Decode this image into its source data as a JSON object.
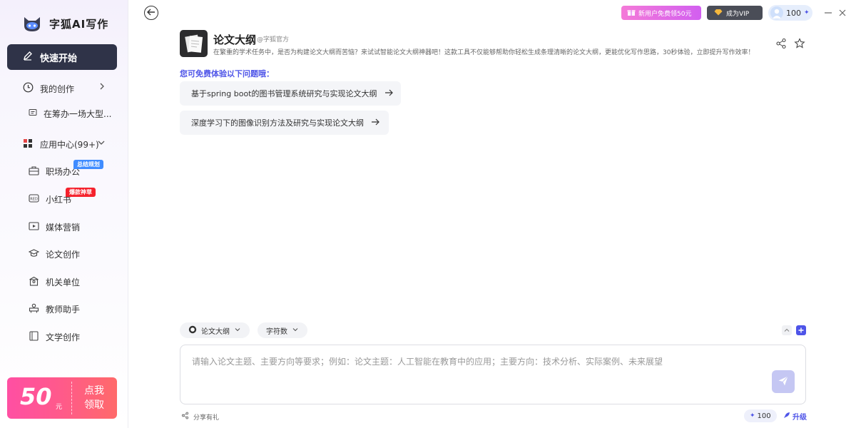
{
  "brand": {
    "name": "字狐AI写作"
  },
  "sidebar": {
    "quick_start": "快速开始",
    "my_creations": "我的创作",
    "recent_item": "在筹办一场大型...",
    "app_center": "应用中心(99+)",
    "apps": [
      {
        "label": "职场办公",
        "badge": "总结规划"
      },
      {
        "label": "小红书",
        "badge": "爆款神草"
      },
      {
        "label": "媒体营销"
      },
      {
        "label": "论文创作"
      },
      {
        "label": "机关单位"
      },
      {
        "label": "教师助手"
      },
      {
        "label": "文学创作"
      }
    ],
    "promo": {
      "amount": "50",
      "unit": "元",
      "cta_line1": "点我",
      "cta_line2": "领取"
    }
  },
  "topbar": {
    "new_user": "新用户免费领50元",
    "vip": "成为VIP",
    "credits": "100"
  },
  "app_header": {
    "title": "论文大纲",
    "author": "@字狐官方",
    "description": "在繁重的学术任务中，是否为构建论文大纲而苦恼？来试试智能论文大纲神器吧！这款工具不仅能够帮助你轻松生成条理清晰的论文大纲，更能优化写作思路，30秒体验，立即提升写作效率！"
  },
  "suggestions": {
    "title": "您可免费体验以下问题哦：",
    "items": [
      "基于spring boot的图书管理系统研究与实现论文大纲",
      "深度学习下的图像识别方法及研究与实现论文大纲"
    ]
  },
  "composer": {
    "mode_chip": "论文大纲",
    "words_chip": "字符数",
    "placeholder": "请输入论文主题、主要方向等要求；例如：论文主题：人工智能在教育中的应用；主要方向：技术分析、实际案例、未来展望",
    "value": ""
  },
  "footer": {
    "share": "分享有礼",
    "credits": "100",
    "upgrade": "升级"
  },
  "colors": {
    "accent": "#4e54e8",
    "sidebar_active": "#2f3348",
    "promo": "#ff5a8a"
  }
}
